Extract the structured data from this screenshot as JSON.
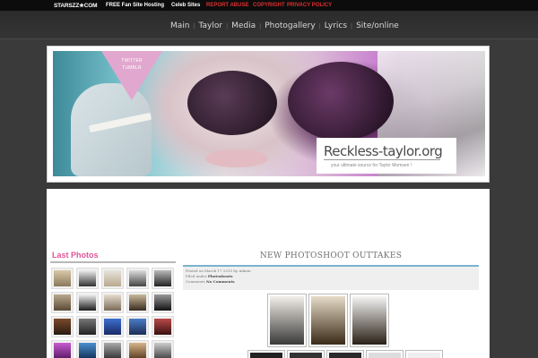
{
  "topbar": {
    "logo": "STARSZZ★COM",
    "links": [
      {
        "label": "FREE Fan Site Hosting",
        "color": "#ffffff"
      },
      {
        "label": "Celeb Sites",
        "color": "#ffffff"
      },
      {
        "label": "REPORT ABUSE",
        "color": "#e03030"
      },
      {
        "label": "COPYRIGHT",
        "color": "#e03030"
      },
      {
        "label": "PRIVACY POLICY",
        "color": "#e03030"
      }
    ]
  },
  "nav": {
    "items": [
      "Main",
      "Taylor",
      "Media",
      "Photogallery",
      "Lyrics",
      "Site/online"
    ],
    "separator": "|"
  },
  "banner": {
    "social_top": "TWITTER",
    "social_bottom": "TUMBLR",
    "site_title": "Reckless-taylor.org",
    "site_subtitle": "your ultimate source for Taylor Momsen !"
  },
  "sidebar": {
    "title": "Last Photos"
  },
  "post": {
    "title": "NEW PHOTOSHOOT OUTTAKES",
    "meta_line1": "Posted on March 17 2015 by Admin",
    "meta_line2_label": "Filed under",
    "meta_line2_value": "Photoshoots",
    "meta_line3_label": "Comments",
    "meta_line3_value": "No Comments"
  },
  "colors": {
    "accent_pink": "#e0559a",
    "accent_blue": "#7ab3cf",
    "topbar_red": "#e03030"
  }
}
